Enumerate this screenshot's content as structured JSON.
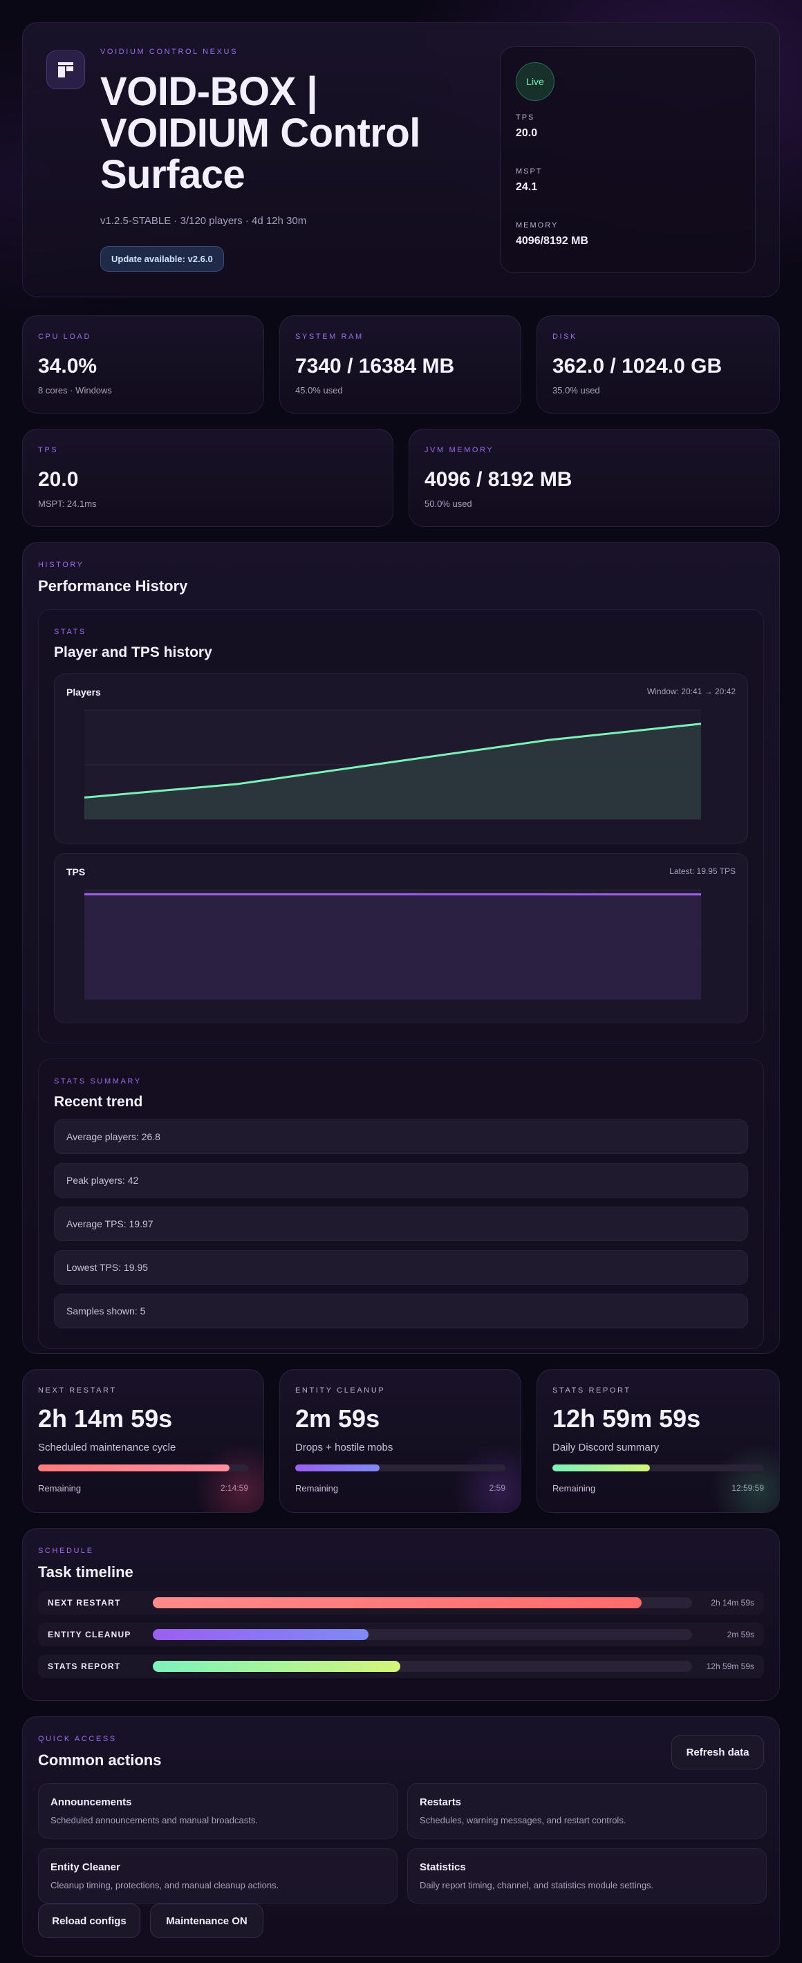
{
  "hero": {
    "eyebrow": "VOIDIUM CONTROL NEXUS",
    "title": "VOID-BOX | VOIDIUM Control Surface",
    "subtitle": "v1.2.5-STABLE · 3/120 players · 4d 12h 30m",
    "update_badge": "Update available: v2.6.0",
    "logo_icon": "server-icon"
  },
  "live": {
    "status": "Live",
    "tps_label": "TPS",
    "tps_value": "20.0",
    "mspt_label": "MSPT",
    "mspt_value": "24.1",
    "memory_label": "MEMORY",
    "memory_value": "4096/8192 MB"
  },
  "stats_top": [
    {
      "label": "CPU LOAD",
      "value": "34.0%",
      "sub": "8 cores · Windows"
    },
    {
      "label": "SYSTEM RAM",
      "value": "7340 / 16384 MB",
      "sub": "45.0% used"
    },
    {
      "label": "DISK",
      "value": "362.0 / 1024.0 GB",
      "sub": "35.0% used"
    }
  ],
  "stats_mid": [
    {
      "label": "TPS",
      "value": "20.0",
      "sub": "MSPT: 24.1ms"
    },
    {
      "label": "JVM MEMORY",
      "value": "4096 / 8192 MB",
      "sub": "50.0% used"
    }
  ],
  "history": {
    "eyebrow": "HISTORY",
    "title": "Performance History",
    "stats_eyebrow": "STATS",
    "stats_title": "Player and TPS history"
  },
  "chart_data": [
    {
      "type": "area",
      "title": "Players",
      "annotation": "Window: 20:41 → 20:42",
      "x": [
        1,
        2,
        3,
        4,
        5
      ],
      "values": [
        8,
        13,
        21,
        29,
        35
      ],
      "ylim": [
        0,
        40
      ],
      "color": "#7cf2bb",
      "fill": "#2b3a3c"
    },
    {
      "type": "area",
      "title": "TPS",
      "annotation": "Latest: 19.95 TPS",
      "x": [
        1,
        2,
        3,
        4,
        5
      ],
      "values": [
        19.97,
        19.97,
        19.97,
        19.96,
        19.95
      ],
      "ylim": [
        0,
        20.8
      ],
      "color": "#9f5ff0",
      "fill": "#2e2145"
    }
  ],
  "summary": {
    "eyebrow": "STATS SUMMARY",
    "title": "Recent trend",
    "items": [
      "Average players: 26.8",
      "Peak players: 42",
      "Average TPS: 19.97",
      "Lowest TPS: 19.95",
      "Samples shown: 5"
    ]
  },
  "timers": [
    {
      "label": "NEXT RESTART",
      "value": "2h 14m 59s",
      "desc": "Scheduled maintenance cycle",
      "remaining_label": "Remaining",
      "remaining": "2:14:59",
      "progress": 0.91,
      "color_a": "#ff7a7a",
      "color_b": "#ff8fa0",
      "glow": "rgba(230,70,110,.28)"
    },
    {
      "label": "ENTITY CLEANUP",
      "value": "2m 59s",
      "desc": "Drops + hostile mobs",
      "remaining_label": "Remaining",
      "remaining": "2:59",
      "progress": 0.4,
      "color_a": "#9b5ff0",
      "color_b": "#7e8af5",
      "glow": "rgba(150,80,230,.22)"
    },
    {
      "label": "STATS REPORT",
      "value": "12h 59m 59s",
      "desc": "Daily Discord summary",
      "remaining_label": "Remaining",
      "remaining": "12:59:59",
      "progress": 0.46,
      "color_a": "#7cf2bb",
      "color_b": "#d4f57a",
      "glow": "rgba(90,200,140,.22)"
    }
  ],
  "schedule": {
    "eyebrow": "SCHEDULE",
    "title": "Task timeline",
    "rows": [
      {
        "label": "NEXT RESTART",
        "value": "2h 14m 59s",
        "progress": 0.907,
        "color_a": "#ff8a8a",
        "color_b": "#ff6b6b"
      },
      {
        "label": "ENTITY CLEANUP",
        "value": "2m 59s",
        "progress": 0.4,
        "color_a": "#9b5ff0",
        "color_b": "#7e8af5"
      },
      {
        "label": "STATS REPORT",
        "value": "12h 59m 59s",
        "progress": 0.459,
        "color_a": "#7cf2bb",
        "color_b": "#d4f57a"
      }
    ]
  },
  "quick": {
    "eyebrow": "QUICK ACCESS",
    "title": "Common actions",
    "refresh": "Refresh data",
    "tiles": [
      {
        "title": "Announcements",
        "desc": "Scheduled announcements and manual broadcasts."
      },
      {
        "title": "Restarts",
        "desc": "Schedules, warning messages, and restart controls."
      },
      {
        "title": "Entity Cleaner",
        "desc": "Cleanup timing, protections, and manual cleanup actions."
      },
      {
        "title": "Statistics",
        "desc": "Daily report timing, channel, and statistics module settings."
      }
    ],
    "reload": "Reload configs",
    "maintenance": "Maintenance ON"
  }
}
